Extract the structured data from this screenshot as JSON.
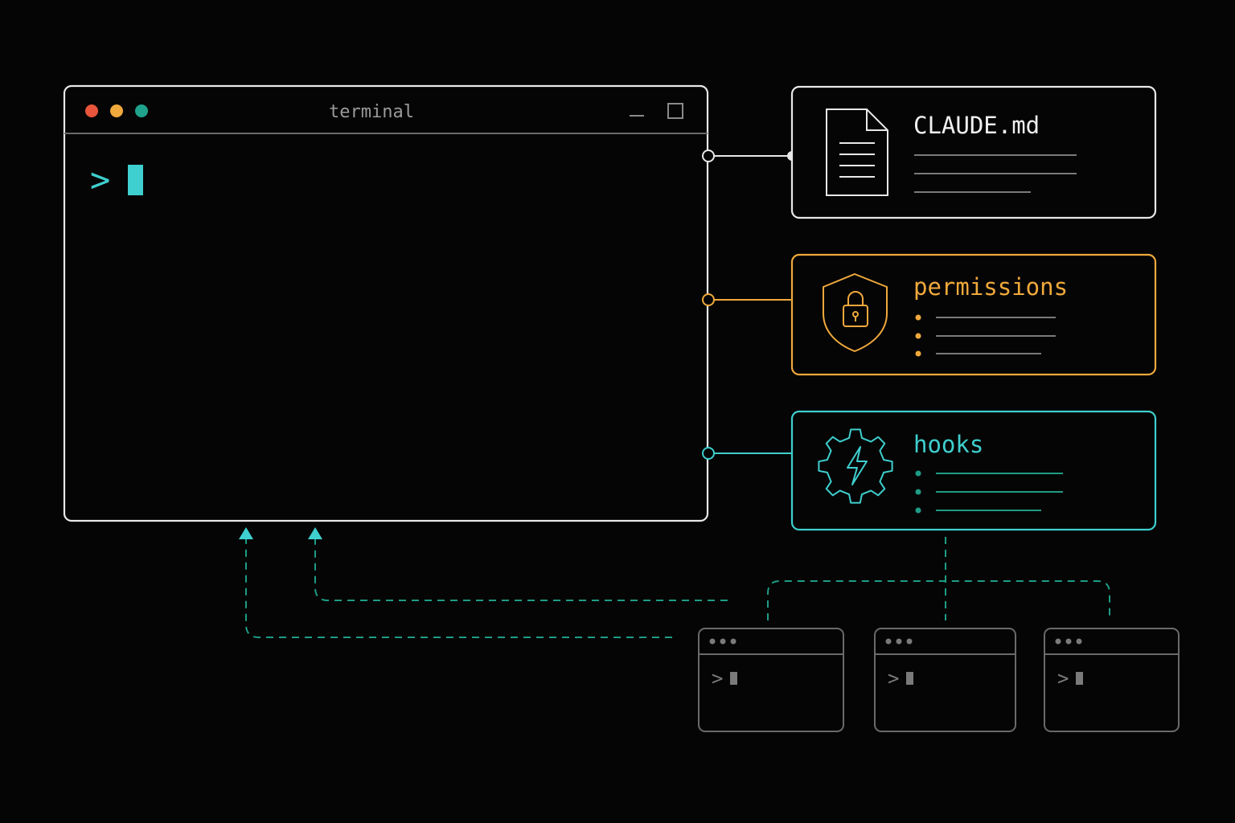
{
  "colors": {
    "background": "#050505",
    "frame": "#e8e8e8",
    "dim_frame": "#6a6a6a",
    "accent_orange": "#f0a93c",
    "accent_teal": "#3fcfcf",
    "accent_green": "#1e9c86",
    "dot_red": "#e8553c",
    "dot_yellow": "#f0a93c",
    "dot_green": "#1fa38c"
  },
  "terminal": {
    "title": "terminal",
    "prompt": ">",
    "icons": [
      "minimize-icon",
      "maximize-icon"
    ]
  },
  "cards": {
    "claude_md": {
      "title": "CLAUDE.md",
      "icon": "document-icon"
    },
    "permissions": {
      "title": "permissions",
      "icon": "shield-lock-icon"
    },
    "hooks": {
      "title": "hooks",
      "icon": "gear-lightning-icon"
    }
  },
  "subagents": [
    {
      "prompt": ">"
    },
    {
      "prompt": ">"
    },
    {
      "prompt": ">"
    }
  ]
}
